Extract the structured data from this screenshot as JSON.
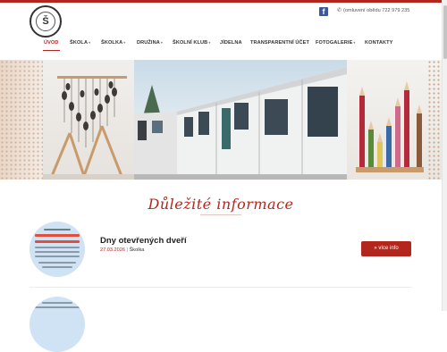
{
  "header": {
    "logo_mark": "Š",
    "logo_alt": "school-logo",
    "facebook_icon": "facebook-icon",
    "phone_text": "(omluvení obědu 722 979 235"
  },
  "nav": {
    "items": [
      {
        "label": "ÚVOD",
        "active": true,
        "dropdown": false
      },
      {
        "label": "ŠKOLA",
        "active": false,
        "dropdown": true
      },
      {
        "label": "ŠKOLKA",
        "active": false,
        "dropdown": true
      },
      {
        "label": "DRUŽINA",
        "active": false,
        "dropdown": true
      },
      {
        "label": "ŠKOLNÍ KLUB",
        "active": false,
        "dropdown": true
      },
      {
        "label": "JÍDELNA",
        "active": false,
        "dropdown": false
      },
      {
        "label": "TRANSPARENTNÍ ÚČET",
        "active": false,
        "dropdown": false
      },
      {
        "label": "FOTOGALERIE",
        "active": false,
        "dropdown": true
      },
      {
        "label": "KONTAKTY",
        "active": false,
        "dropdown": false
      }
    ],
    "caret": "▾"
  },
  "slider": {
    "active_index": 0,
    "slide_count": 4
  },
  "section": {
    "title": "Důležité informace"
  },
  "news": [
    {
      "title": "Dny otevřených dveří",
      "date": "27.03.2026",
      "separator": "|",
      "category": "Školka",
      "button": "» více info"
    }
  ],
  "colors": {
    "accent": "#b3261e",
    "facebook": "#3b5998"
  }
}
